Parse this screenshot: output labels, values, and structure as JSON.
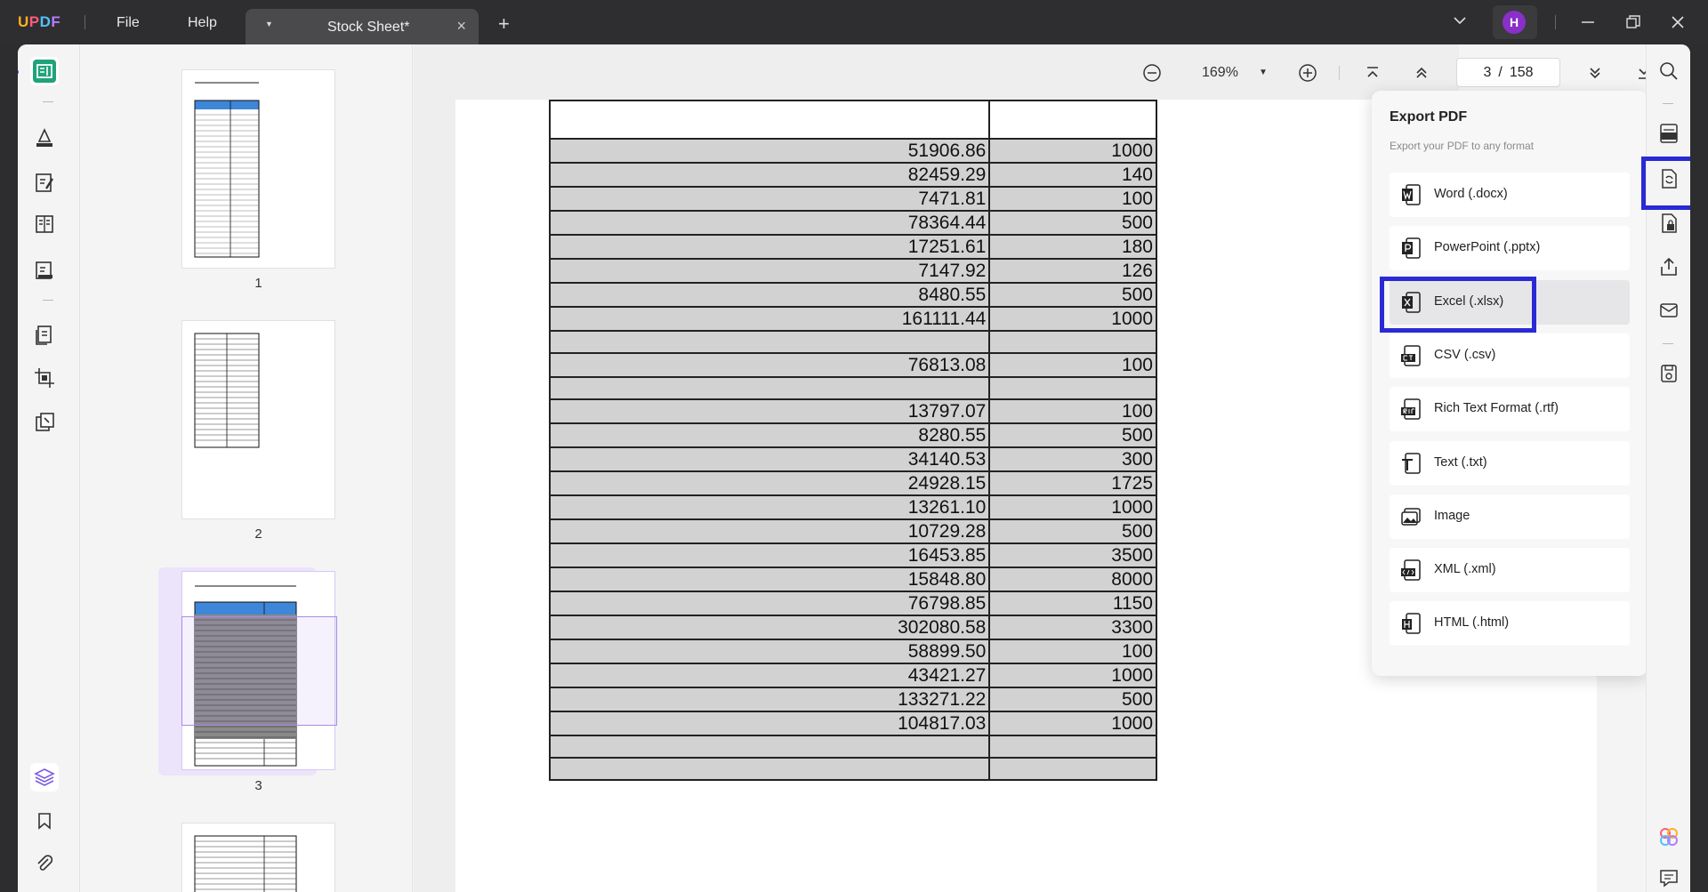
{
  "app": {
    "logo": [
      "U",
      "P",
      "D",
      "F"
    ]
  },
  "menu": {
    "file": "File",
    "help": "Help"
  },
  "tab": {
    "title": "Stock Sheet*",
    "close": "×"
  },
  "tabbar": {
    "new_tab": "+"
  },
  "user": {
    "initial": "H"
  },
  "toolbar": {
    "zoom": "169%",
    "current_page": "3",
    "page_sep": "/",
    "total_pages": "158"
  },
  "thumbnails": [
    {
      "label": "1"
    },
    {
      "label": "2"
    },
    {
      "label": "3"
    }
  ],
  "table": {
    "rows": [
      [
        "",
        ""
      ],
      [
        "51906.86",
        "1000"
      ],
      [
        "82459.29",
        "140"
      ],
      [
        "7471.81",
        "100"
      ],
      [
        "78364.44",
        "500"
      ],
      [
        "17251.61",
        "180"
      ],
      [
        "7147.92",
        "126"
      ],
      [
        "8480.55",
        "500"
      ],
      [
        "161111.44",
        "1000"
      ],
      [
        "",
        ""
      ],
      [
        "76813.08",
        "100"
      ],
      [
        "",
        ""
      ],
      [
        "13797.07",
        "100"
      ],
      [
        "8280.55",
        "500"
      ],
      [
        "34140.53",
        "300"
      ],
      [
        "24928.15",
        "1725"
      ],
      [
        "13261.10",
        "1000"
      ],
      [
        "10729.28",
        "500"
      ],
      [
        "16453.85",
        "3500"
      ],
      [
        "15848.80",
        "8000"
      ],
      [
        "76798.85",
        "1150"
      ],
      [
        "302080.58",
        "3300"
      ],
      [
        "58899.50",
        "100"
      ],
      [
        "43421.27",
        "1000"
      ],
      [
        "133271.22",
        "500"
      ],
      [
        "104817.03",
        "1000"
      ],
      [
        "",
        ""
      ],
      [
        "",
        ""
      ]
    ]
  },
  "export": {
    "title": "Export PDF",
    "subtitle": "Export your PDF to any format",
    "items": [
      {
        "label": "Word (.docx)",
        "icon": "word-icon"
      },
      {
        "label": "PowerPoint (.pptx)",
        "icon": "powerpoint-icon"
      },
      {
        "label": "Excel (.xlsx)",
        "icon": "excel-icon"
      },
      {
        "label": "CSV (.csv)",
        "icon": "csv-icon"
      },
      {
        "label": "Rich Text Format (.rtf)",
        "icon": "rtf-icon"
      },
      {
        "label": "Text (.txt)",
        "icon": "text-icon"
      },
      {
        "label": "Image",
        "icon": "image-icon"
      },
      {
        "label": "XML (.xml)",
        "icon": "xml-icon"
      },
      {
        "label": "HTML (.html)",
        "icon": "html-icon"
      }
    ]
  },
  "colors": {
    "accent": "#2a2ad4",
    "avatar": "#8a2fc8",
    "reader_active": "#1fa37a",
    "table_fill": "#d2d2d2"
  }
}
